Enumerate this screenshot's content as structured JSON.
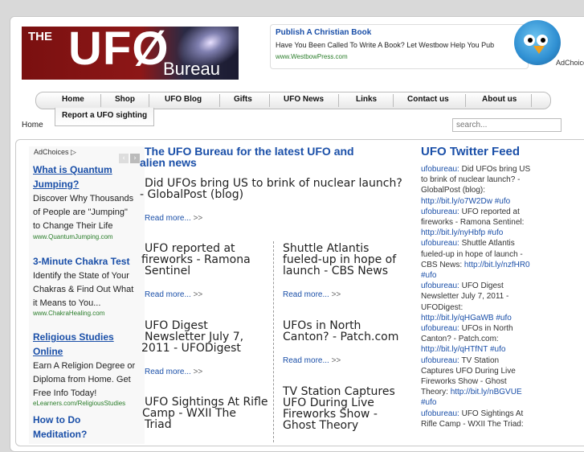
{
  "logo": {
    "the": "THE",
    "ufo": "UFØ",
    "bureau": "Bureau"
  },
  "top_ad": {
    "title": "Publish A Christian Book",
    "desc": "Have You Been Called To Write A Book? Let Westbow Help You Pub",
    "url": "www.WestbowPress.com",
    "adchoices": "AdChoice"
  },
  "nav": {
    "items": [
      "Home",
      "Shop",
      "UFO Blog",
      "Gifts",
      "UFO News",
      "Links",
      "Contact us",
      "About us"
    ],
    "second_row": "Report a UFO sighting"
  },
  "breadcrumb": "Home",
  "search": {
    "placeholder": "search..."
  },
  "left_ad": {
    "adchoices": "AdChoices",
    "ads": [
      {
        "title_1": "What is Quantum",
        "title_2": "Jumping?",
        "body": [
          "Discover Why Thousands",
          "of People are \"Jumping\"",
          "to Change Their Life"
        ],
        "url": "www.QuantumJumping.com"
      },
      {
        "title_1": "3-Minute Chakra Test",
        "body": [
          "Identify the State of Your",
          "Chakras & Find Out What",
          "it Means to You..."
        ],
        "url": "www.ChakraHealing.com"
      },
      {
        "title_1": "Religious Studies",
        "title_2": "Online",
        "body": [
          "Earn A Religion Degree or",
          "Diploma from Home. Get",
          "Free Info Today!"
        ],
        "url": "eLearners.com/ReligiousStudies"
      },
      {
        "title_1": "How to Do",
        "title_2": "Meditation?"
      }
    ]
  },
  "main": {
    "title_1": "The UFO Bureau for the latest UFO and",
    "title_2": "alien news",
    "read_more": "Read more...",
    "read_more_arrow": ">>",
    "posts": [
      {
        "lines": [
          "Did UFOs bring US to brink of nuclear launch?",
          "- GlobalPost (blog)"
        ]
      },
      {
        "lines": [
          "UFO reported at",
          "fireworks - Ramona",
          "Sentinel"
        ]
      },
      {
        "lines": [
          "Shuttle Atlantis",
          "fueled-up in hope of",
          "launch - CBS News"
        ]
      },
      {
        "lines": [
          "UFO Digest",
          "Newsletter July 7,",
          "2011 - UFODigest"
        ]
      },
      {
        "lines": [
          "UFOs in North",
          "Canton? - Patch.com"
        ]
      },
      {
        "lines": [
          "UFO Sightings At Rifle",
          "Camp - WXII The",
          "Triad"
        ]
      },
      {
        "lines": [
          "TV Station Captures",
          "UFO During Live",
          "Fireworks Show -",
          "Ghost Theory"
        ]
      }
    ]
  },
  "twitter": {
    "title": "UFO Twitter Feed",
    "lines": [
      [
        "ufobureau:",
        " Did UFOs bring US"
      ],
      [
        "",
        "to brink of nuclear launch? -"
      ],
      [
        "",
        "GlobalPost (blog):"
      ],
      [
        "http://bit.ly/o7W2Dw #ufo",
        ""
      ],
      [
        "ufobureau:",
        " UFO reported at"
      ],
      [
        "",
        "fireworks - Ramona Sentinel:"
      ],
      [
        "http://bit.ly/nyHbfp #ufo",
        ""
      ],
      [
        "ufobureau:",
        " Shuttle Atlantis"
      ],
      [
        "",
        "fueled-up in hope of launch -"
      ],
      [
        "",
        "CBS News: "
      ],
      [
        "#ufo",
        ""
      ],
      [
        "ufobureau:",
        " UFO Digest"
      ],
      [
        "",
        "Newsletter July 7, 2011 -"
      ],
      [
        "",
        "UFODigest:"
      ],
      [
        "http://bit.ly/qHGaWB #ufo",
        ""
      ],
      [
        "ufobureau:",
        " UFOs in North"
      ],
      [
        "",
        "Canton? - Patch.com:"
      ],
      [
        "http://bit.ly/qHTfNT #ufo",
        ""
      ],
      [
        "ufobureau:",
        " TV Station"
      ],
      [
        "",
        "Captures UFO During Live"
      ],
      [
        "",
        "Fireworks Show - Ghost"
      ],
      [
        "",
        "Theory: "
      ],
      [
        "#ufo",
        ""
      ],
      [
        "ufobureau:",
        " UFO Sightings At"
      ],
      [
        "",
        "Rifle Camp - WXII The Triad:"
      ]
    ],
    "inline_links": {
      "cbs": "http://bit.ly/nzfHR0",
      "theory": "http://bit.ly/nBGVUE"
    }
  }
}
